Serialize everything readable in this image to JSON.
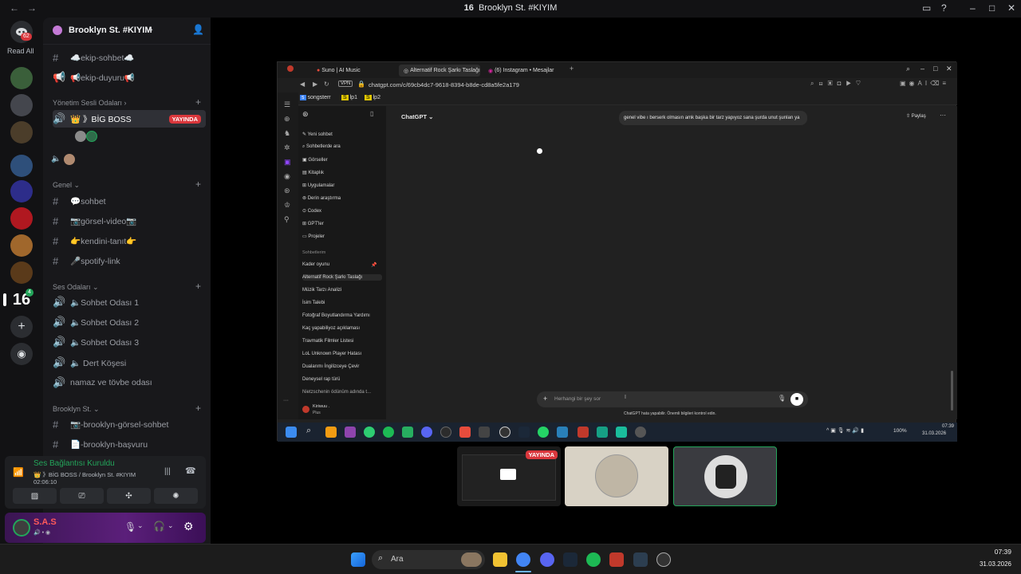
{
  "titlebar": {
    "title": "Brooklyn St. #KIYIM",
    "logo": "16"
  },
  "rail": {
    "notif_badge": "62",
    "read_all": "Read All",
    "server_badges": [
      "4"
    ]
  },
  "server": {
    "name": "Brooklyn St. #KIYIM",
    "channels_top": [
      "☁️ekip-sohbet☁️",
      "📢ekip-duyuru📢"
    ],
    "cat_admin_voice": "Yönetim Sesli Odaları",
    "boss_channel": "👑 》BİG BOSS",
    "live_label": "YAYINDA",
    "cat_general": "Genel",
    "general_channels": [
      "💬sohbet",
      "📷görsel-video📷",
      "👉kendini-tanıt👉",
      "🎤spotify-link"
    ],
    "cat_voice": "Ses Odaları",
    "voice_channels": [
      "🔈Sohbet Odası 1",
      "🔈Sohbet Odası 2",
      "🔈Sohbet Odası 3",
      "🔈 Dert Köşesi",
      "namaz ve tövbe odası"
    ],
    "cat_brooklyn": "Brooklyn St.",
    "brooklyn_channels": [
      "📷-brooklyn-görsel-sohbet",
      "📄-brooklyn-başvuru"
    ]
  },
  "voice": {
    "status": "Ses Bağlantısı Kuruldu",
    "channel": "👑 》BİG BOSS / Brooklyn St. #KIYIM",
    "timer": "02:06:10"
  },
  "user": {
    "name": "S.A.S"
  },
  "browser": {
    "tabs": [
      "Suno | AI Music",
      "Alternatif Rock Şarkı Taslağı",
      "(6) Instagram • Mesajlar"
    ],
    "url": "chatgpt.com/c/69cb4dc7-9618-8394-b8de-cd8a5fe2a179",
    "vpn": "VPN",
    "bookmarks": [
      "songsterr",
      "lp1",
      "lp2"
    ]
  },
  "gpt": {
    "nav": [
      "Yeni sohbet",
      "Sohbetlerde ara",
      "Görseller",
      "Kitaplık",
      "Uygulamalar",
      "Derin araştırma",
      "Codex",
      "GPT'ler",
      "Projeler"
    ],
    "section": "Sohbetlerim",
    "history": [
      "Kader oyunu",
      "Alternatif Rock Şarkı Taslağı",
      "Müzik Tarzı Analizi",
      "İsim Talebi",
      "Fotoğraf Boyutlandırma Yardımı",
      "Kaç yapabiliyoz açıklaması",
      "Travmatik Filmler Listesi",
      "LoL Unknown Player Hatası",
      "Dualarımı İngilizceye Çevir",
      "Deneysel rap türü",
      "Nietzschenin ödünüm adında t..."
    ],
    "account": "Kiriwuu .",
    "plan": "Plus",
    "model": "ChatGPT",
    "share": "Paylaş",
    "message": "genel vibe ı berserk olmasın amk başka bir tarz yapıyoz sana şurda unut şunları ya",
    "placeholder": "Herhangi bir şey sor",
    "disclaimer": "ChatGPT hata yapabilir. Önemli bilgileri kontrol edin.",
    "clock": "07:39",
    "date": "31.03.2026",
    "battery": "100%"
  },
  "thumbs": {
    "live": "YAYINDA"
  },
  "taskbar": {
    "search": "Ara",
    "time": "07:39",
    "date": "31.03.2026"
  }
}
